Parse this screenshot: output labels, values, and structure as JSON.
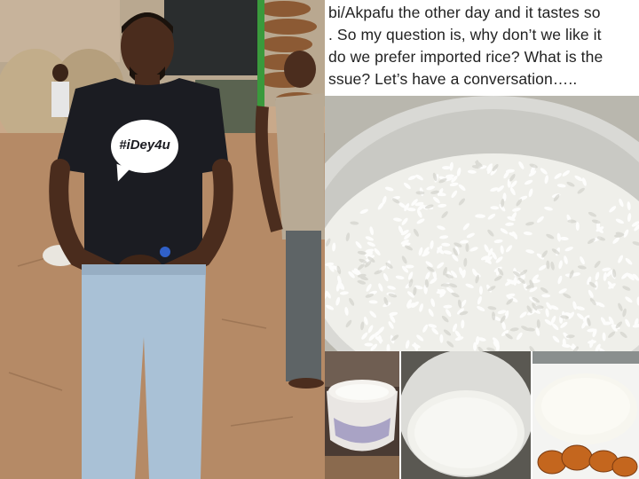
{
  "post_caption": {
    "lines": [
      "bi/Akpafu the other day and it tastes so",
      ". So my question is, why don’t we like it",
      "do we prefer imported rice? What is the",
      "ssue? Let’s have a conversation….."
    ]
  },
  "tshirt": {
    "slogan": "#iDey4u"
  },
  "colors": {
    "shirt": "#1b1c22",
    "jeans": "#a9c1d6",
    "ground": "#b58a66",
    "bowl": "#d9d9d5",
    "rice": "#efefea",
    "plantain": "#c4661e"
  }
}
